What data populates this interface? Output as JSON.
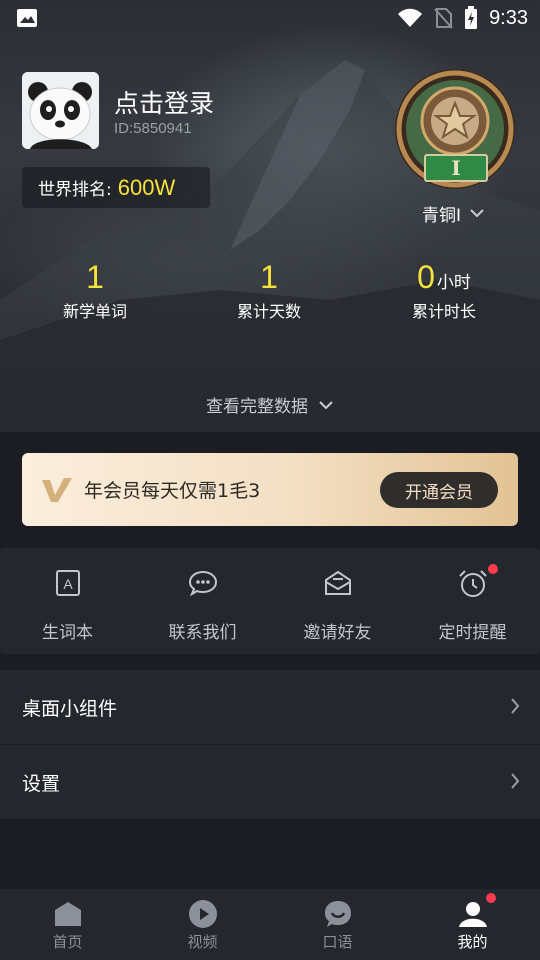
{
  "status_bar": {
    "time": "9:33"
  },
  "profile": {
    "login_text": "点击登录",
    "user_id": "ID:5850941",
    "rank_label": "世界排名:",
    "rank_value": "600W",
    "level_label": "青铜I",
    "badge_numeral": "I"
  },
  "stats": [
    {
      "value": "1",
      "unit": "",
      "label": "新学单词"
    },
    {
      "value": "1",
      "unit": "",
      "label": "累计天数"
    },
    {
      "value": "0",
      "unit": "小时",
      "label": "累计时长"
    }
  ],
  "full_data_link": "查看完整数据",
  "vip": {
    "text": "年会员每天仅需1毛3",
    "button": "开通会员",
    "colors": {
      "banner_start": "#fbeedd",
      "banner_end": "#e2c395",
      "button_bg": "#2f2e2d"
    }
  },
  "quick_actions": [
    {
      "label": "生词本",
      "icon": "vocabulary-book-icon",
      "dot": false
    },
    {
      "label": "联系我们",
      "icon": "chat-bubble-icon",
      "dot": false
    },
    {
      "label": "邀请好友",
      "icon": "envelope-icon",
      "dot": false
    },
    {
      "label": "定时提醒",
      "icon": "alarm-clock-icon",
      "dot": true
    }
  ],
  "menu": [
    {
      "label": "桌面小组件"
    },
    {
      "label": "设置"
    }
  ],
  "tabbar": [
    {
      "label": "首页",
      "icon": "home-icon",
      "active": false,
      "dot": false
    },
    {
      "label": "视频",
      "icon": "play-icon",
      "active": false,
      "dot": false
    },
    {
      "label": "口语",
      "icon": "speech-icon",
      "active": false,
      "dot": false
    },
    {
      "label": "我的",
      "icon": "profile-icon",
      "active": true,
      "dot": true
    }
  ],
  "colors": {
    "accent_yellow": "#f6e23a",
    "notification_red": "#ff3b4e",
    "panel_bg": "#25272e",
    "page_bg": "#1c1d22"
  }
}
